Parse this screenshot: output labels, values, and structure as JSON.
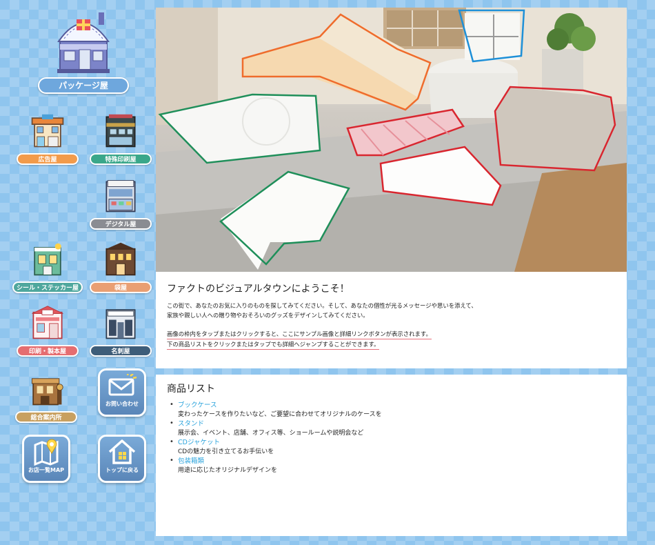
{
  "sidebar": {
    "main_shop": {
      "label": "パッケージ屋"
    },
    "shops": [
      {
        "label": "広告屋"
      },
      {
        "label": "特殊印刷屋"
      },
      {
        "label": "デジタル屋"
      },
      {
        "label": "シール・ステッカー屋"
      },
      {
        "label": "袋屋"
      },
      {
        "label": "印刷・製本屋"
      },
      {
        "label": "名刺屋"
      },
      {
        "label": "総合案内所"
      }
    ],
    "buttons": {
      "contact": "お問い合わせ",
      "map": "お店一覧MAP",
      "top": "トップに戻る"
    }
  },
  "welcome": {
    "title": "ファクトのビジュアルタウンにようこそ！",
    "line1": "この街で、あなたのお気に入りのものを探してみてください。そして、あなたの個性が光るメッセージや思いを添えて、",
    "line2": "家族や親しい人への贈り物やおそろいのグッズをデザインしてみてください。",
    "line3": "画像の枠内をタップまたはクリックすると、ここにサンプル画像と詳細リンクボタンが表示されます。",
    "line4": "下の商品リストをクリックまたはタップでも詳細へジャンプすることができます。"
  },
  "products": {
    "title": "商品リスト",
    "items": [
      {
        "name": "ブックケース",
        "desc": "変わったケースを作りたいなど、ご要望に合わせてオリジナルのケースを"
      },
      {
        "name": "スタンド",
        "desc": "展示会、イベント、店舗、オフィス等、ショールームや説明会など"
      },
      {
        "name": "CDジャケット",
        "desc": "CDの魅力を引き立てるお手伝いを"
      },
      {
        "name": "包装箱類",
        "desc": "用途に応じたオリジナルデザインを"
      }
    ]
  },
  "colors": {
    "background": "#8fc5ee",
    "link": "#2aa3dc",
    "highlight_orange": "#ef6c2c",
    "highlight_blue": "#1e90d8",
    "highlight_green": "#1f8f5a",
    "highlight_red": "#d9262f",
    "underline": "#e8707a"
  }
}
